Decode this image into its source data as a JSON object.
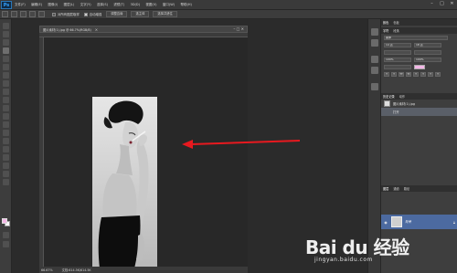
{
  "app": {
    "logo": "Ps"
  },
  "menu": [
    "文件(F)",
    "编辑(E)",
    "图像(I)",
    "图层(L)",
    "文字(Y)",
    "选择(S)",
    "滤镜(T)",
    "3D(D)",
    "视图(V)",
    "窗口(W)",
    "帮助(H)"
  ],
  "options": {
    "check1": "对所有图层取样",
    "check2": "自动增强",
    "btn1": "调整边缘",
    "btn2": "选主体",
    "btn3": "选择并遮住"
  },
  "document": {
    "tab_title": "图片素材(1).jpg @ 66.7%(RGB/8)",
    "zoom": "66.67%",
    "doc_info": "文档:614.5K/614.5K"
  },
  "panels": {
    "top_tabs": [
      "颜色",
      "色板"
    ],
    "char_tabs": [
      "字符",
      "段落"
    ],
    "font_family": "黑体",
    "font_size": "14 点",
    "leading": "18 点",
    "scale_v": "100%",
    "scale_h": "100%",
    "history_tabs": [
      "历史记录",
      "动作"
    ],
    "history_items": [
      "图片素材(1).jpg",
      "打开"
    ],
    "layers_tabs": [
      "图层",
      "通道",
      "路径"
    ],
    "layer_name": "背景"
  },
  "watermark": {
    "brand": "Bai du 经验",
    "url": "jingyan.baidu.com"
  },
  "colors": {
    "foreground": "#f4b6e6",
    "arrow": "#e8191f",
    "accent": "#4c6aa0"
  }
}
